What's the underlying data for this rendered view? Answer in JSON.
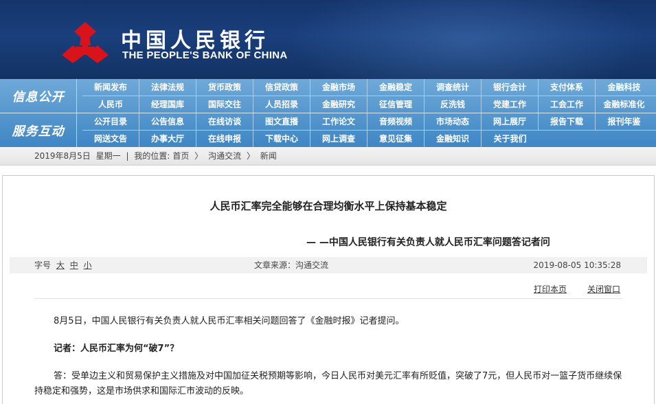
{
  "header": {
    "cn_title": "中国人民银行",
    "en_title": "THE PEOPLE'S BANK OF CHINA",
    "logo": "pboc-emblem-icon",
    "colors": {
      "banner": "#14346b",
      "logo_red": "#d8131b",
      "nav": "#4b8fc9"
    }
  },
  "nav": {
    "sections": [
      {
        "label": "信息公开",
        "rows": [
          [
            "新闻发布",
            "法律法规",
            "货币政策",
            "信贷政策",
            "金融市场",
            "金融稳定",
            "调查统计",
            "银行会计",
            "支付体系",
            "金融科技"
          ],
          [
            "人民币",
            "经理国库",
            "国际交往",
            "人员招录",
            "金融研究",
            "征信管理",
            "反洗钱",
            "党建工作",
            "工会工作",
            "金融标准化"
          ]
        ]
      },
      {
        "label": "服务互动",
        "rows": [
          [
            "公开目录",
            "公告信息",
            "在线访谈",
            "图文直播",
            "工作论文",
            "音频视频",
            "市场动态",
            "网上展厅",
            "报告下载",
            "报刊年鉴"
          ],
          [
            "网送文告",
            "办事大厅",
            "在线申报",
            "下载中心",
            "网上调查",
            "意见征集",
            "金融知识",
            "关于我们",
            "",
            ""
          ]
        ]
      }
    ]
  },
  "breadcrumb": {
    "date": "2019年8月5日",
    "weekday": "星期一",
    "location_label": "我的位置:",
    "home": "首页",
    "sep": "〉",
    "level1": "沟通交流",
    "level2": "新闻"
  },
  "article": {
    "title": "人民币汇率完全能够在合理均衡水平上保持基本稳定",
    "subtitle": "— —中国人民银行有关负责人就人民币汇率问题答记者问",
    "font_size_label": "字号",
    "font_sizes": [
      "大",
      "中",
      "小"
    ],
    "source": "文章来源：沟通交流",
    "datetime": "2019-08-05 10:35:28",
    "print_label": "打印本页",
    "close_label": "关闭窗口",
    "paragraphs": [
      "8月5日，中国人民银行有关负责人就人民币汇率相关问题回答了《金融时报》记者提问。",
      "记者：人民币汇率为何“破7”？",
      "答：受单边主义和贸易保护主义措施及对中国加征关税预期等影响，今日人民币对美元汇率有所贬值，突破了7元，但人民币对一篮子货币继续保持稳定和强势，这是市场供求和国际汇市波动的反映。"
    ]
  }
}
